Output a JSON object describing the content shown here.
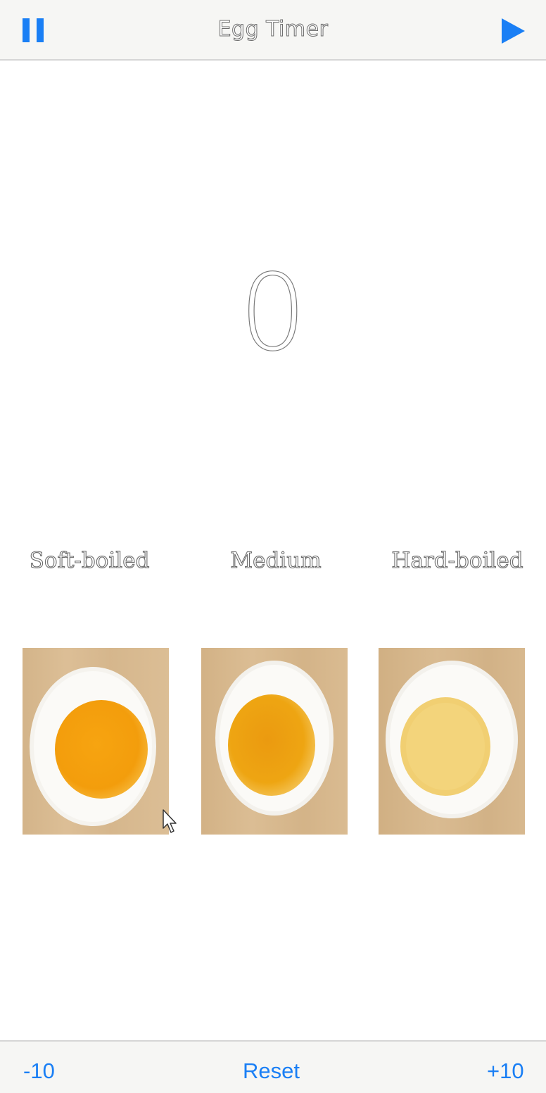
{
  "navbar": {
    "title": "Egg Timer",
    "pause_icon": "pause-icon",
    "play_icon": "play-icon"
  },
  "timer": {
    "value": "0"
  },
  "eggs": [
    {
      "label": "Soft-boiled",
      "image": "soft-boiled-egg-photo",
      "yolk_color": "#f5a40c"
    },
    {
      "label": "Medium",
      "image": "medium-egg-photo",
      "yolk_color": "#eea512"
    },
    {
      "label": "Hard-boiled",
      "image": "hard-boiled-egg-photo",
      "yolk_color": "#f1cf72"
    }
  ],
  "toolbar": {
    "minus_label": "-10",
    "reset_label": "Reset",
    "plus_label": "+10"
  },
  "colors": {
    "accent": "#1a7ff5",
    "bar_background": "#f6f6f4",
    "wood": "#d9bb92"
  }
}
